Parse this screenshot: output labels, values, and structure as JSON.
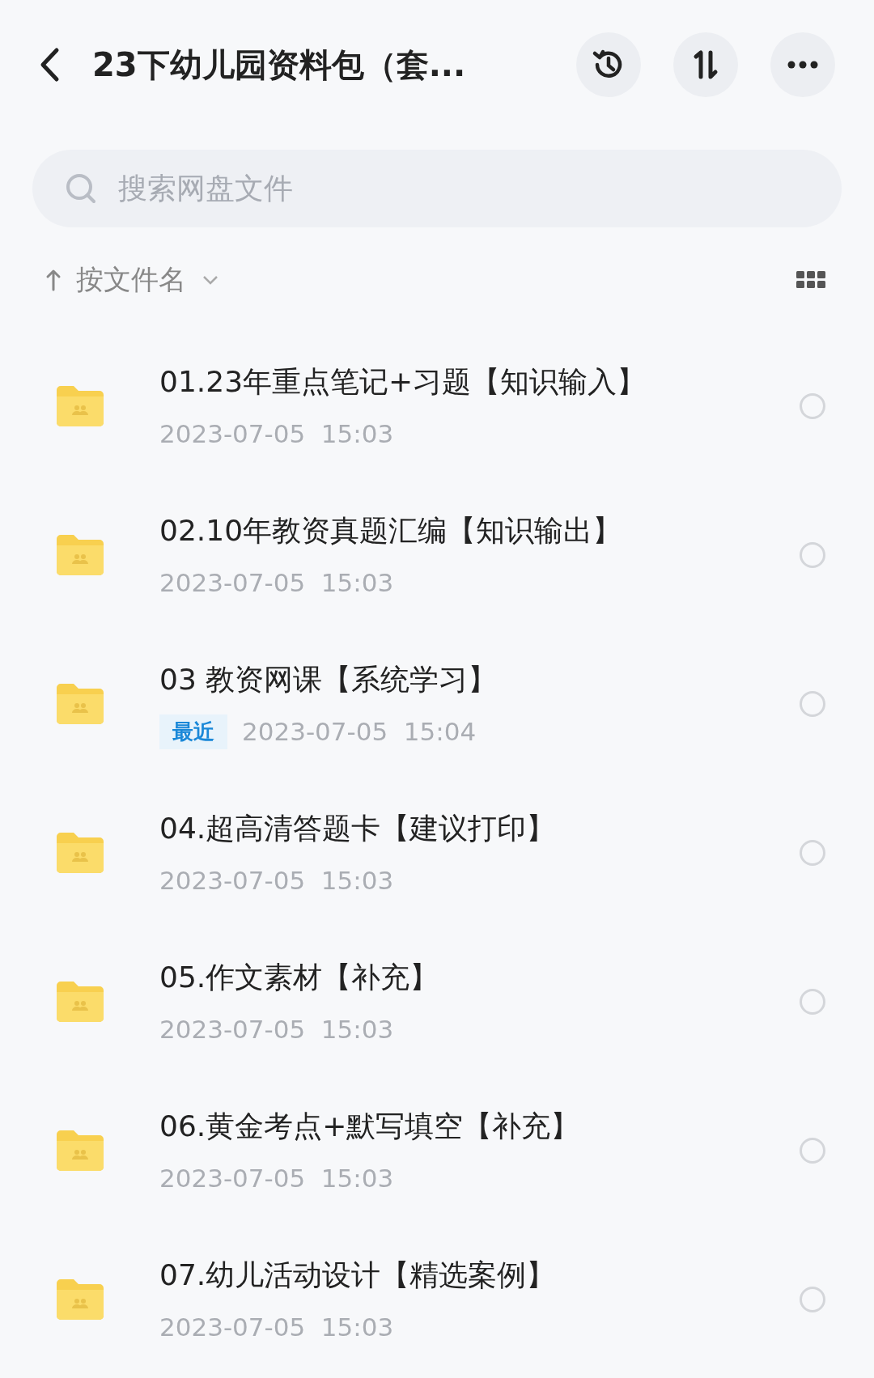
{
  "header": {
    "title": "23下幼儿园资料包（套..."
  },
  "search": {
    "placeholder": "搜索网盘文件"
  },
  "sort": {
    "label": "按文件名"
  },
  "files": [
    {
      "name": "01.23年重点笔记+习题【知识输入】",
      "date": "2023-07-05  15:03",
      "recent": false,
      "checked": false
    },
    {
      "name": "02.10年教资真题汇编【知识输出】",
      "date": "2023-07-05  15:03",
      "recent": false,
      "checked": false
    },
    {
      "name": "03 教资网课【系统学习】",
      "date": "2023-07-05  15:04",
      "recent": true,
      "badge": "最近",
      "checked": false
    },
    {
      "name": "04.超高清答题卡【建议打印】",
      "date": "2023-07-05  15:03",
      "recent": false,
      "checked": false
    },
    {
      "name": "05.作文素材【补充】",
      "date": "2023-07-05  15:03",
      "recent": false,
      "checked": false
    },
    {
      "name": "06.黄金考点+默写填空【补充】",
      "date": "2023-07-05  15:03",
      "recent": false,
      "checked": false
    },
    {
      "name": "07.幼儿活动设计【精选案例】",
      "date": "2023-07-05  15:03",
      "recent": false,
      "checked": false
    }
  ]
}
